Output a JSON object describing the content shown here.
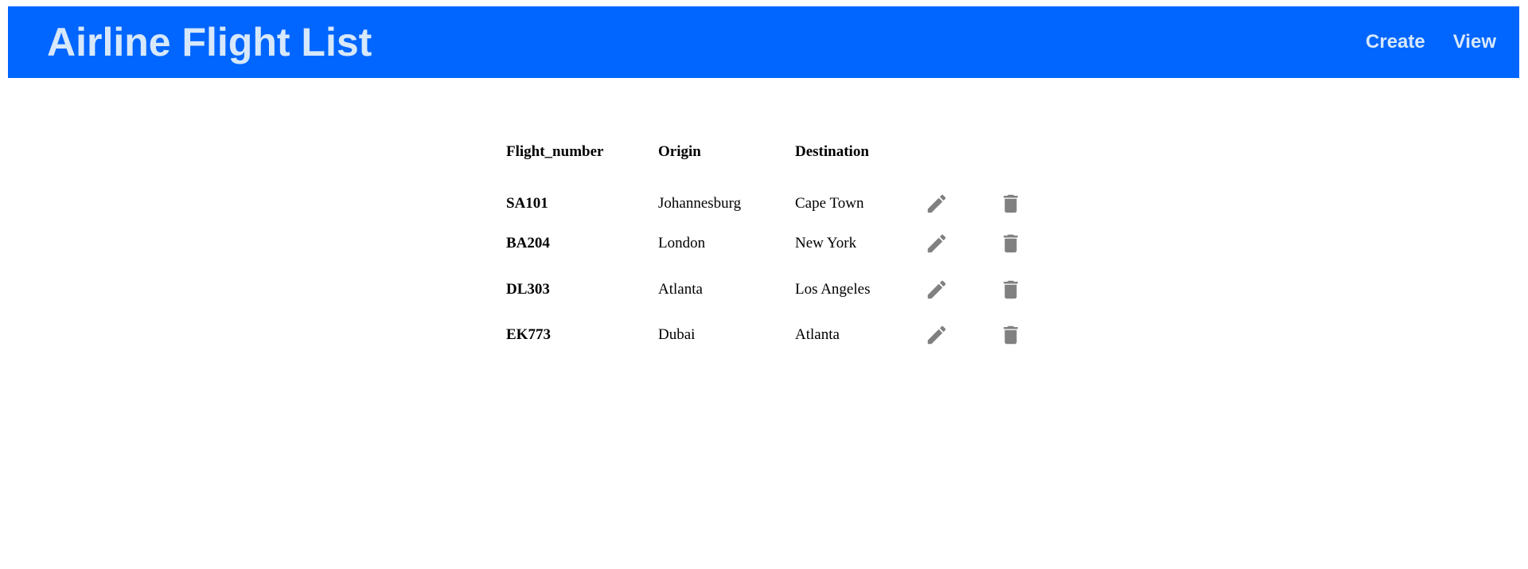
{
  "header": {
    "title": "Airline Flight List",
    "nav": [
      {
        "label": "Create"
      },
      {
        "label": "View"
      }
    ]
  },
  "table": {
    "columns": [
      "Flight_number",
      "Origin",
      "Destination"
    ],
    "rows": [
      {
        "flight_number": "SA101",
        "origin": "Johannesburg",
        "destination": "Cape Town"
      },
      {
        "flight_number": "BA204",
        "origin": "London",
        "destination": "New York"
      },
      {
        "flight_number": "DL303",
        "origin": "Atlanta",
        "destination": "Los Angeles"
      },
      {
        "flight_number": "EK773",
        "origin": "Dubai",
        "destination": "Atlanta"
      }
    ],
    "row_actions": [
      "pencil-icon",
      "trash-icon"
    ]
  },
  "colors": {
    "header_bg": "#0066ff",
    "header_text": "#d7e8fb",
    "icon": "#808080"
  }
}
